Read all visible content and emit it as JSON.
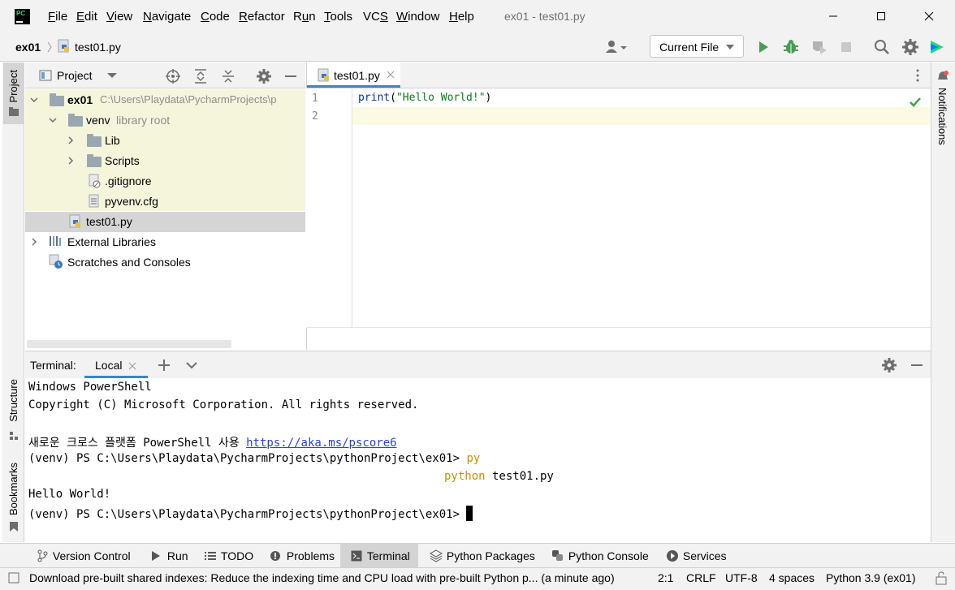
{
  "app": {
    "window_title": "ex01 - test01.py",
    "menu": [
      "File",
      "Edit",
      "View",
      "Navigate",
      "Code",
      "Refactor",
      "Run",
      "Tools",
      "VCS",
      "Window",
      "Help"
    ],
    "menu_mnemonic": [
      "F",
      "E",
      "V",
      "N",
      "C",
      "R",
      "u",
      "T",
      "S",
      "W",
      "H"
    ]
  },
  "navbar": {
    "breadcrumb_project": "ex01",
    "breadcrumb_file": "test01.py",
    "run_config": "Current File"
  },
  "left_stripe": {
    "project": "Project",
    "structure": "Structure",
    "bookmarks": "Bookmarks"
  },
  "right_stripe": {
    "notifications": "Notifications"
  },
  "project_panel": {
    "title": "Project",
    "tree": [
      {
        "label": "ex01",
        "hint": "C:\\Users\\Playdata\\PycharmProjects\\p"
      },
      {
        "label": "venv",
        "hint": "library root"
      },
      {
        "label": "Lib"
      },
      {
        "label": "Scripts"
      },
      {
        "label": ".gitignore"
      },
      {
        "label": "pyvenv.cfg"
      },
      {
        "label": "test01.py"
      },
      {
        "label": "External Libraries"
      },
      {
        "label": "Scratches and Consoles"
      }
    ]
  },
  "editor": {
    "tab": "test01.py",
    "line_numbers": [
      "1",
      "2"
    ],
    "code": {
      "func": "print",
      "open": "(",
      "string": "\"Hello World!\"",
      "close": ")"
    }
  },
  "terminal": {
    "title": "Terminal:",
    "tab": "Local",
    "lines": {
      "l1": "Windows PowerShell",
      "l2": "Copyright (C) Microsoft Corporation. All rights reserved.",
      "l3_text": "새로운 크로스 플랫폼 PowerShell 사용 ",
      "l3_link": "https://aka.ms/pscore6",
      "prompt": "(venv) PS C:\\Users\\Playdata\\PycharmProjects\\pythonProject\\ex01> ",
      "cmd1": "py",
      "cmd2_kw": "python",
      "cmd2_arg": " test01.py",
      "output": "Hello World!"
    }
  },
  "bottom_tools": [
    "Version Control",
    "Run",
    "TODO",
    "Problems",
    "Terminal",
    "Python Packages",
    "Python Console",
    "Services"
  ],
  "status": {
    "message": "Download pre-built shared indexes: Reduce the indexing time and CPU load with pre-built Python p... (a minute ago)",
    "position": "2:1",
    "line_sep": "CRLF",
    "encoding": "UTF-8",
    "indent": "4 spaces",
    "interpreter": "Python 3.9 (ex01)"
  },
  "colors": {
    "accent": "#2675bf",
    "string": "#067d17",
    "keyword": "#0033b3",
    "run_green": "#499c54",
    "highlight_line": "#fcfae3",
    "tree_highlight": "#f5f5dc",
    "cmd_yellow": "#c29200"
  }
}
